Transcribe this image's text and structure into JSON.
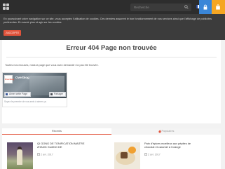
{
  "header": {
    "search_placeholder": "Recherche",
    "flag_colors": [
      "#2c4a9a",
      "#ffffff",
      "#d33a33"
    ],
    "user_color": "#3a86d8",
    "cart_color": "#f5a623"
  },
  "cookie": {
    "text": "En poursuivant votre navigation sur ce site, vous acceptez l'utilisation de cookies. Ces derniers assurent le bon fonctionnement de nos services ainsi que l'affichage de publicités pertinentes. En savoir plus et agir sur les cookies",
    "button_label": "J'ACCEPTE",
    "button_color": "#e0533b"
  },
  "main": {
    "title": "Erreur 404 Page non trouvée",
    "message": "Toutes nos excuses, mais la page que vous avez demandé n'a pas été trouvée."
  },
  "facebook": {
    "thumb_text": "Overblog",
    "page_name": "Overblog",
    "likes": "",
    "like_label": "Aimer cette Page",
    "share_label": "Partager",
    "footer": "Soyez le premier de vos amis à aimer ça."
  },
  "tabs": {
    "recents": "Récents",
    "populaires": "Populaires",
    "accent": "#e2533b"
  },
  "posts": [
    {
      "title": "QI GONG DE TONIFICATION MAITRE ZHANG GUANG DE",
      "date": "2 avr. 2017"
    },
    {
      "title": "Pain d'épices moelleux aux pépites de chocolat et caramel à l'orange",
      "date": "2 avr. 2017"
    }
  ]
}
